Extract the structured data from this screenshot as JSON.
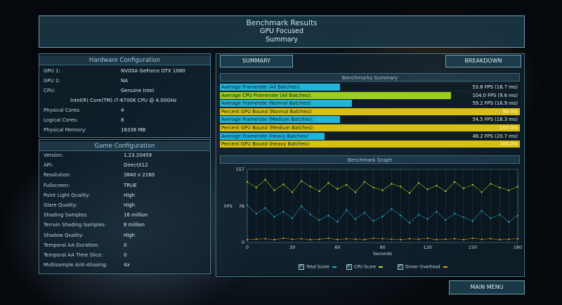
{
  "header": {
    "title": "Benchmark Results",
    "subtitle": "GPU Focused",
    "mode": "Summary"
  },
  "hardware": {
    "title": "Hardware Configuration",
    "rows": [
      {
        "label": "GPU 1:",
        "value": "NVIDIA GeForce GTX 1080"
      },
      {
        "label": "GPU 2:",
        "value": "NA"
      },
      {
        "label": "CPU:",
        "value": "Genuine Intel"
      },
      {
        "label": "",
        "value": "Intel(R) Core(TM) i7-6700K CPU @ 4.00GHz"
      },
      {
        "label": "Physical Cores:",
        "value": "4"
      },
      {
        "label": "Logical Cores:",
        "value": "8"
      },
      {
        "label": "Physical Memory:",
        "value": "16336  MB"
      }
    ]
  },
  "game": {
    "title": "Game Configuration",
    "rows": [
      {
        "label": "Version:",
        "value": "1.23.20459"
      },
      {
        "label": "API:",
        "value": "DirectX12"
      },
      {
        "label": "Resolution:",
        "value": "3840 x 2160"
      },
      {
        "label": "Fullscreen:",
        "value": "TRUE"
      },
      {
        "label": "Point Light Quality:",
        "value": "High"
      },
      {
        "label": "Glare Quality:",
        "value": "High"
      },
      {
        "label": "Shading Samples:",
        "value": "16 million"
      },
      {
        "label": "Terrain Shading Samples:",
        "value": "8 million"
      },
      {
        "label": "Shadow Quality:",
        "value": "High"
      },
      {
        "label": "Temporal AA Duration:",
        "value": "0"
      },
      {
        "label": "Temporal AA Time Slice:",
        "value": "0"
      },
      {
        "label": "Multisample Anti-Aliasing:",
        "value": "4x"
      }
    ]
  },
  "tabs": {
    "summary": "SUMMARY",
    "breakdown": "BREAKDOWN"
  },
  "summary": {
    "title": "Benchmarks Summary",
    "rows": [
      {
        "label": "Average Framerate (All Batches):",
        "value": "53.6 FPS (18.7 ms)",
        "fraction": 0.4,
        "color": "#22b4d8"
      },
      {
        "label": "Average CPU Framerate (All Batches):",
        "value": "104.0 FPS (9.6 ms)",
        "fraction": 0.77,
        "color": "#9ccf1c"
      },
      {
        "label": "Average Framerate (Normal Batches):",
        "value": "59.2 FPS (16.9 ms)",
        "fraction": 0.44,
        "color": "#22b4d8"
      },
      {
        "label": "Percent GPU Bound (Normal Batches):",
        "value": "99.9%",
        "fraction": 1.0,
        "color": "#d8c010"
      },
      {
        "label": "Average Framerate (Medium Batches):",
        "value": "54.5 FPS (18.3 ms)",
        "fraction": 0.4,
        "color": "#22b4d8"
      },
      {
        "label": "Percent GPU Bound (Medium Batches):",
        "value": "100.0%",
        "fraction": 1.0,
        "color": "#d8c010"
      },
      {
        "label": "Average Framerate (Heavy Batches):",
        "value": "48.2 FPS (20.7 ms)",
        "fraction": 0.35,
        "color": "#22b4d8"
      },
      {
        "label": "Percent GPU Bound (Heavy Batches):",
        "value": "100.0%",
        "fraction": 1.0,
        "color": "#d8c010"
      }
    ]
  },
  "graph": {
    "title": "Benchmark Graph",
    "ylabel": "FPS",
    "xlabel": "Seconds",
    "legend": [
      {
        "label": "Total Score",
        "color": "#2aa8d0"
      },
      {
        "label": "CPU Score",
        "color": "#b8e020"
      },
      {
        "label": "Driver Overhead",
        "color": "#e0a020"
      }
    ]
  },
  "chart_data": {
    "type": "scatter",
    "title": "Benchmark Graph",
    "xlabel": "Seconds",
    "ylabel": "FPS",
    "xlim": [
      0,
      180
    ],
    "ylim": [
      0,
      157
    ],
    "xticks": [
      0,
      30,
      60,
      90,
      120,
      150,
      180
    ],
    "yticks": [
      0,
      78,
      157
    ],
    "series": [
      {
        "name": "CPU Score",
        "color": "#b8e020",
        "x": [
          0,
          6,
          12,
          18,
          24,
          30,
          36,
          42,
          48,
          54,
          60,
          66,
          72,
          78,
          84,
          90,
          96,
          102,
          108,
          114,
          120,
          126,
          132,
          138,
          144,
          150,
          156,
          162,
          168,
          174,
          180
        ],
        "y": [
          130,
          118,
          135,
          112,
          125,
          108,
          132,
          120,
          110,
          128,
          115,
          124,
          108,
          130,
          118,
          112,
          126,
          120,
          106,
          128,
          114,
          122,
          110,
          130,
          116,
          124,
          108,
          126,
          118,
          112,
          120
        ]
      },
      {
        "name": "Total Score",
        "color": "#2aa8d0",
        "x": [
          0,
          6,
          12,
          18,
          24,
          30,
          36,
          42,
          48,
          54,
          60,
          66,
          72,
          78,
          84,
          90,
          96,
          102,
          108,
          114,
          120,
          126,
          132,
          138,
          144,
          150,
          156,
          162,
          168,
          174,
          180
        ],
        "y": [
          80,
          62,
          74,
          55,
          66,
          52,
          78,
          60,
          48,
          58,
          44,
          70,
          50,
          64,
          46,
          56,
          72,
          58,
          42,
          60,
          50,
          66,
          48,
          62,
          54,
          46,
          68,
          52,
          60,
          44,
          58
        ]
      },
      {
        "name": "Driver Overhead",
        "color": "#e0a020",
        "x": [
          0,
          6,
          12,
          18,
          24,
          30,
          36,
          42,
          48,
          54,
          60,
          66,
          72,
          78,
          84,
          90,
          96,
          102,
          108,
          114,
          120,
          126,
          132,
          138,
          144,
          150,
          156,
          162,
          168,
          174,
          180
        ],
        "y": [
          6,
          7,
          8,
          6,
          9,
          7,
          8,
          6,
          7,
          9,
          6,
          8,
          7,
          6,
          9,
          8,
          7,
          6,
          8,
          7,
          9,
          6,
          7,
          8,
          6,
          9,
          7,
          8,
          6,
          7,
          8
        ]
      }
    ]
  },
  "footer": {
    "main_menu": "MAIN MENU"
  }
}
